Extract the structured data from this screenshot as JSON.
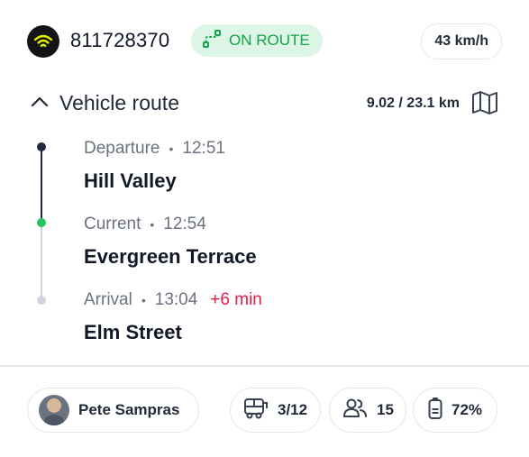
{
  "header": {
    "vehicle_id": "811728370",
    "status": "ON ROUTE",
    "speed": "43 km/h",
    "colors": {
      "status_bg": "#dcf5e6",
      "status_fg": "#16a34a"
    }
  },
  "route": {
    "title": "Vehicle route",
    "distance": "9.02 / 23.1 km",
    "stops": [
      {
        "type": "Departure",
        "time": "12:51",
        "name": "Hill Valley"
      },
      {
        "type": "Current",
        "time": "12:54",
        "name": "Evergreen Terrace"
      },
      {
        "type": "Arrival",
        "time": "13:04",
        "delay": "+6 min",
        "name": "Elm Street"
      }
    ]
  },
  "footer": {
    "driver": "Pete Sampras",
    "seats": "3/12",
    "passengers": "15",
    "battery": "72%"
  },
  "icons": [
    "wifi-icon",
    "route-icon",
    "chevron-up-icon",
    "map-icon",
    "bus-icon",
    "users-icon",
    "battery-icon"
  ]
}
